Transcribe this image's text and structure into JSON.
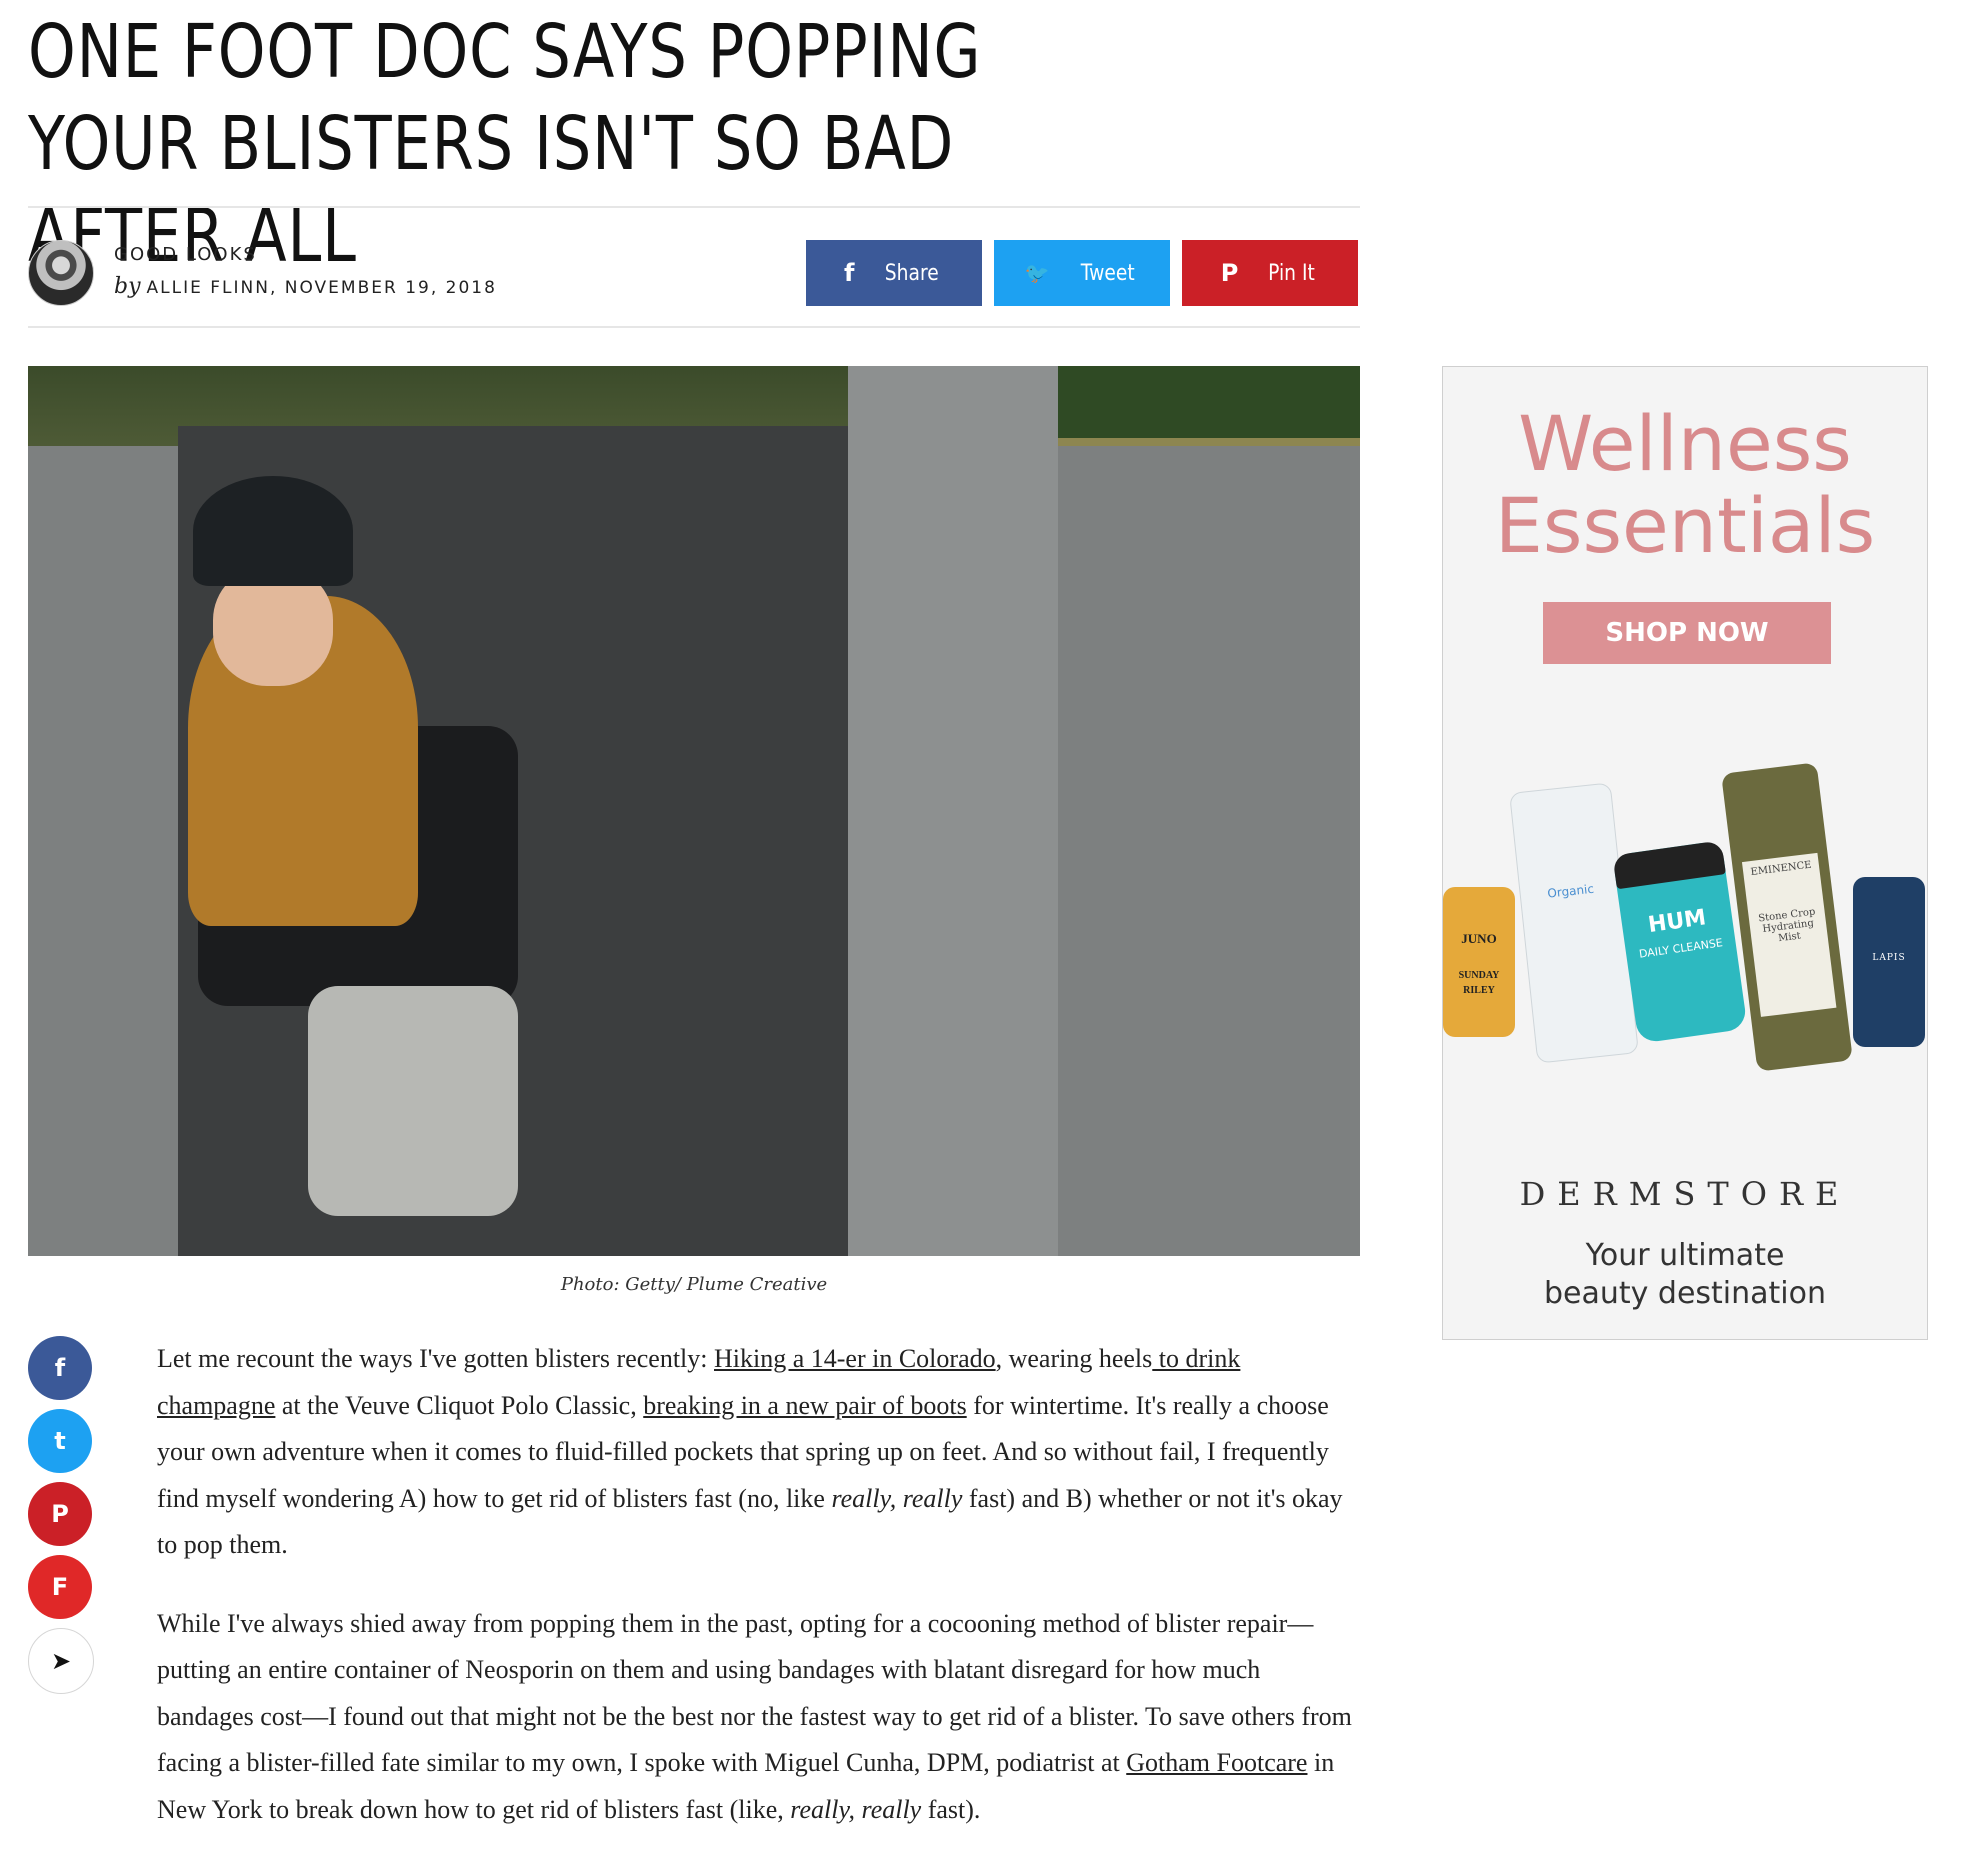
{
  "headline": "One Foot Doc Says Popping Your Blisters Isn't So Bad After All",
  "byline": {
    "section": "GOOD LOOKS",
    "by": "by",
    "author_date": "ALLIE FLINN, NOVEMBER 19, 2018"
  },
  "share": {
    "facebook": "Share",
    "twitter": "Tweet",
    "pinterest": "Pin It",
    "facebook_icon": "f",
    "twitter_icon": "🐦",
    "pinterest_icon": "P"
  },
  "hero": {
    "caption": "Photo: Getty/ Plume Creative"
  },
  "social_rail": {
    "facebook_icon": "f",
    "twitter_icon": "t",
    "pinterest_icon": "P",
    "flipboard_icon": "F",
    "email_icon": "➤"
  },
  "article": {
    "p1": {
      "t1": "Let me recount the ways I've gotten blisters recently: ",
      "l1": "Hiking a 14-er in Colorado",
      "t2": ", wearing heels",
      "l2": " to drink champagne",
      "t3": " at the Veuve Cliquot Polo Classic, ",
      "l3": "breaking in a new pair of boots",
      "t4": " for wintertime. It's really a choose your own adventure when it comes to fluid-filled pockets that spring up on feet. And so without fail, I frequently find myself wondering A) how to get rid of blisters fast (no, like ",
      "em1": "really, really",
      "t5": " fast) and B) whether or not it's okay to pop them."
    },
    "p2": {
      "t1": "While I've always shied away from popping them in the past, opting for a cocooning method of blister repair—putting an entire container of Neosporin on them and using bandages with blatant disregard for how much bandages cost—I found out that might not be the best nor the fastest way to get rid of a blister. To save others from facing a blister-filled fate similar to my own, I spoke with Miguel Cunha, DPM, podiatrist at ",
      "l1": "Gotham Footcare",
      "t2": " in New York to break down how to get rid of blisters fast (like, ",
      "em1": "really, really",
      "t3": " fast)."
    }
  },
  "ad": {
    "title_line1": "Wellness",
    "title_line2": "Essentials",
    "cta": "SHOP NOW",
    "brand": "DERMSTORE",
    "tagline_line1": "Your ultimate",
    "tagline_line2": "beauty destination",
    "products": {
      "juno_l1": "JUNO",
      "juno_l2": "SUNDAY",
      "juno_l3": "RILEY",
      "organic": "Organic",
      "hum_brand": "HUM",
      "hum_product": "DAILY CLEANSE",
      "eminence_brand": "EMINENCE",
      "eminence_product_l1": "Stone Crop",
      "eminence_product_l2": "Hydrating",
      "eminence_product_l3": "Mist",
      "lapis": "LAPIS"
    }
  }
}
